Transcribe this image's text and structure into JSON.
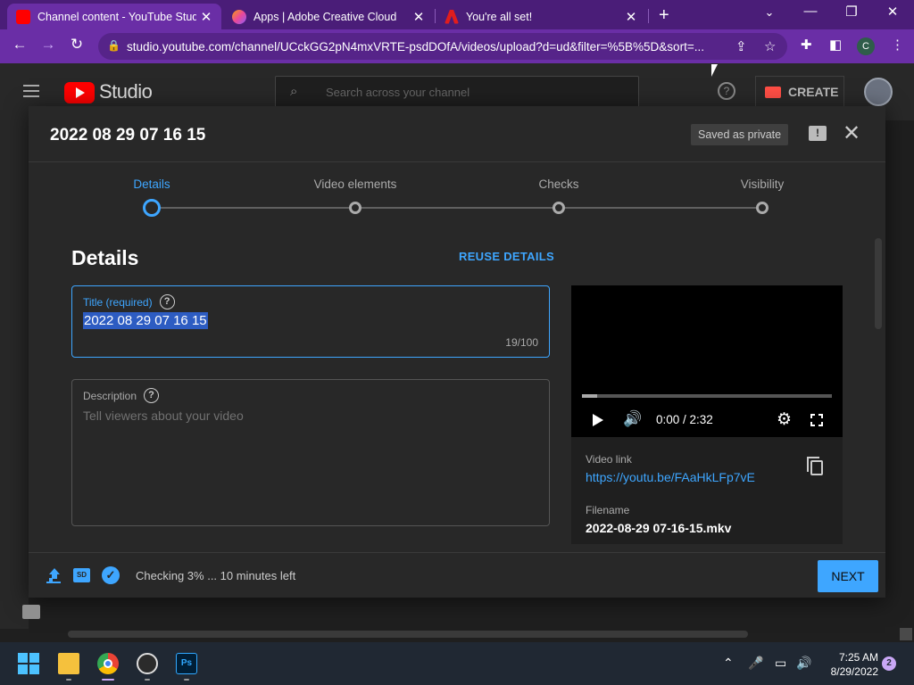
{
  "browser": {
    "tabs": [
      {
        "title": "Channel content - YouTube Studio",
        "close": "✕"
      },
      {
        "title": "Apps | Adobe Creative Cloud",
        "close": "✕"
      },
      {
        "title": "You're all set!",
        "close": "✕"
      }
    ],
    "new_tab": "+",
    "url": "studio.youtube.com/channel/UCckGG2pN4mxVRTE-psdDOfA/videos/upload?d=ud&filter=%5B%5D&sort=...",
    "profile_initial": "C"
  },
  "studio": {
    "logo_text": "Studio",
    "search_placeholder": "Search across your channel",
    "create_label": "CREATE"
  },
  "dialog": {
    "title": "2022 08 29 07 16 15",
    "saved_badge": "Saved as private",
    "steps": [
      {
        "label": "Details",
        "active": true
      },
      {
        "label": "Video elements",
        "active": false
      },
      {
        "label": "Checks",
        "active": false
      },
      {
        "label": "Visibility",
        "active": false
      }
    ],
    "section_heading": "Details",
    "reuse_label": "REUSE DETAILS",
    "title_field": {
      "label": "Title (required)",
      "value": "2022 08 29 07 16 15",
      "counter": "19/100"
    },
    "description_field": {
      "label": "Description",
      "placeholder": "Tell viewers about your video"
    },
    "preview": {
      "time": "0:00 / 2:32",
      "progress_fraction": 0.06,
      "video_link_label": "Video link",
      "video_link": "https://youtu.be/FAaHkLFp7vE",
      "filename_label": "Filename",
      "filename": "2022-08-29 07-16-15.mkv"
    },
    "footer": {
      "status": "Checking 3% ... 10 minutes left",
      "hd_badge": "SD",
      "next_label": "NEXT"
    }
  },
  "taskbar": {
    "time": "7:25 AM",
    "date": "8/29/2022",
    "notifications": "2",
    "apps": [
      "windows-start-icon",
      "file-explorer-icon",
      "chrome-icon",
      "obs-icon",
      "photoshop-icon"
    ],
    "photoshop_label": "Ps"
  },
  "colors": {
    "accent": "#3ea6ff",
    "browser_frame": "#6a2ea6",
    "dialog_bg": "#282828"
  }
}
